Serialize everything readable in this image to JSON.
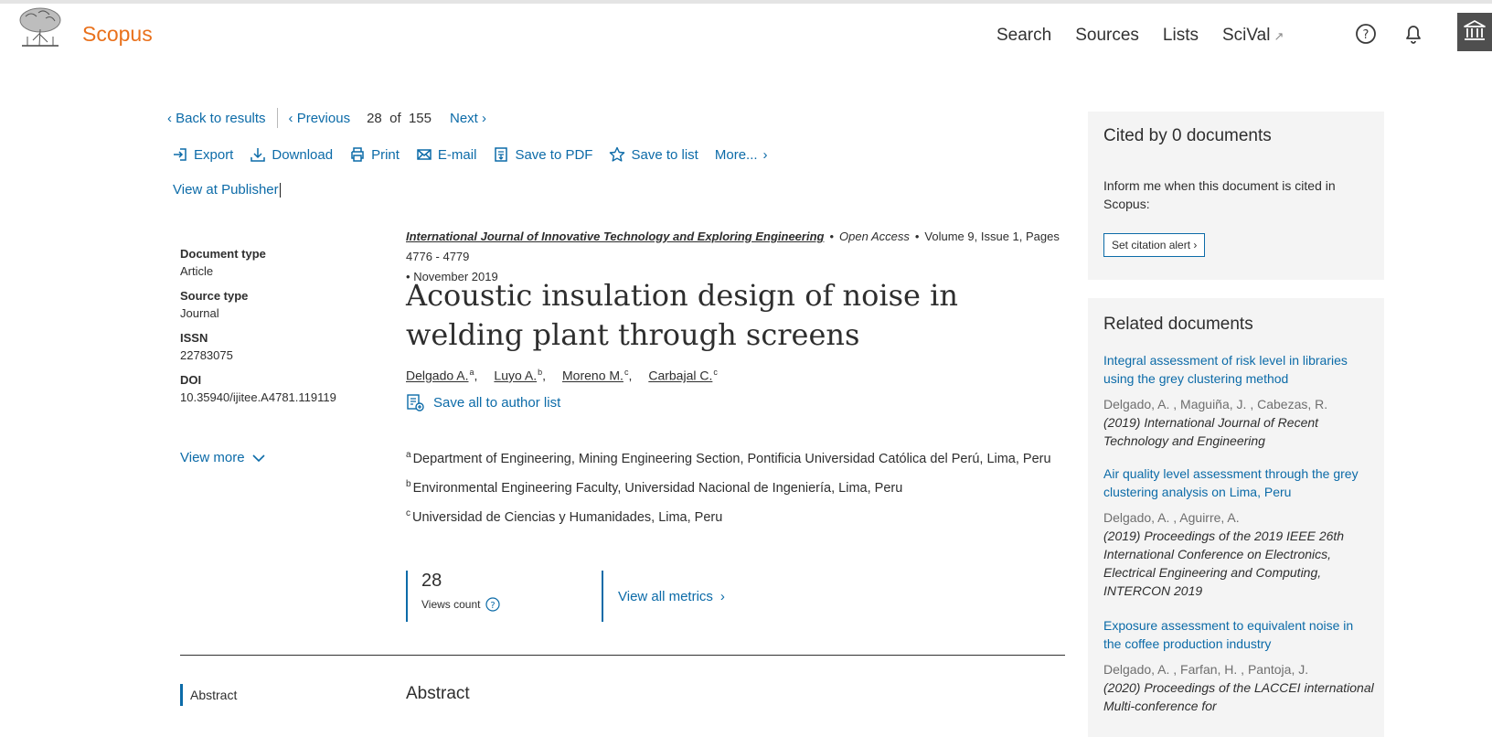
{
  "header": {
    "brand": "Scopus",
    "nav": [
      "Search",
      "Sources",
      "Lists",
      "SciVal"
    ],
    "scival_arrow": "↗",
    "icons": [
      "help-icon",
      "bell-icon",
      "institution-icon"
    ],
    "brand_color": "#e9711c",
    "link_color": "#0c6ba8"
  },
  "docnav": {
    "back": "Back to results",
    "previous": "Previous",
    "position": "28",
    "of": "of",
    "total": "155",
    "next": "Next"
  },
  "toolbar": {
    "export": "Export",
    "download": "Download",
    "print": "Print",
    "email": "E-mail",
    "save_pdf": "Save to PDF",
    "save_list": "Save to list",
    "more": "More..."
  },
  "view_at_publisher": "View at Publisher",
  "meta": {
    "doc_type_label": "Document type",
    "doc_type": "Article",
    "source_type_label": "Source type",
    "source_type": "Journal",
    "issn_label": "ISSN",
    "issn": "22783075",
    "doi_label": "DOI",
    "doi": "10.35940/ijitee.A4781.119119",
    "view_more": "View more"
  },
  "article": {
    "journal": "International Journal of Innovative Technology and Exploring Engineering",
    "open_access": "Open Access",
    "volume": "Volume 9, Issue 1, Pages 4776 - 4779",
    "date": "November 2019",
    "title": "Acoustic insulation design of noise in welding plant through screens",
    "authors": [
      {
        "name": "Delgado A.",
        "sup": "a"
      },
      {
        "name": "Luyo A.",
        "sup": "b"
      },
      {
        "name": "Moreno M.",
        "sup": "c"
      },
      {
        "name": "Carbajal C.",
        "sup": "c"
      }
    ],
    "save_all": "Save all to author list",
    "affiliations": [
      {
        "sup": "a",
        "text": "Department of Engineering, Mining Engineering Section, Pontificia Universidad Católica del Perú, Lima, Peru"
      },
      {
        "sup": "b",
        "text": "Environmental Engineering Faculty, Universidad Nacional de Ingeniería, Lima, Peru"
      },
      {
        "sup": "c",
        "text": "Universidad de Ciencias y Humanidades, Lima, Peru"
      }
    ]
  },
  "metrics": {
    "views": "28",
    "views_label": "Views count",
    "view_all": "View all metrics"
  },
  "abstract": {
    "side_label": "Abstract",
    "heading": "Abstract"
  },
  "cited": {
    "title": "Cited by 0 documents",
    "inform": "Inform me when this document is cited in Scopus:",
    "alert_button": "Set citation alert"
  },
  "related": {
    "title": "Related documents",
    "items": [
      {
        "title": "Integral assessment of risk level in libraries using the grey clustering method",
        "authors": "Delgado, A. , Maguiña, J. , Cabezas, R.",
        "source": "(2019) International Journal of Recent Technology and Engineering"
      },
      {
        "title": "Air quality level assessment through the grey clustering analysis on Lima, Peru",
        "authors": "Delgado, A. , Aguirre, A.",
        "source": "(2019) Proceedings of the 2019 IEEE 26th International Conference on Electronics, Electrical Engineering and Computing, INTERCON 2019"
      },
      {
        "title": "Exposure assessment to equivalent noise in the coffee production industry",
        "authors": "Delgado, A. , Farfan, H. , Pantoja, J.",
        "source": "(2020) Proceedings of the LACCEI international Multi-conference for"
      }
    ]
  }
}
